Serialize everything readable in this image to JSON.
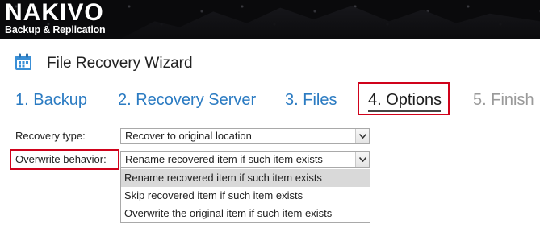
{
  "brand": {
    "name": "NAKIVO",
    "tagline": "Backup & Replication"
  },
  "wizard": {
    "icon": "calendar-icon",
    "title": "File Recovery Wizard"
  },
  "steps": [
    {
      "label": "1. Backup",
      "state": "link"
    },
    {
      "label": "2. Recovery Server",
      "state": "link"
    },
    {
      "label": "3. Files",
      "state": "link"
    },
    {
      "label": "4. Options",
      "state": "active"
    },
    {
      "label": "5. Finish",
      "state": "disabled"
    }
  ],
  "form": {
    "recovery_type": {
      "label": "Recovery type:",
      "value": "Recover to original location"
    },
    "overwrite_behavior": {
      "label": "Overwrite behavior:",
      "value": "Rename recovered item if such item exists",
      "options": [
        "Rename recovered item if such item exists",
        "Skip recovered item if such item exists",
        "Overwrite the original item if such item exists"
      ],
      "selected_index": 0
    }
  },
  "colors": {
    "link": "#2b7bc2",
    "disabled": "#9a9a9a",
    "highlight": "#d0021b",
    "selected_option_bg": "#d9d9d9"
  }
}
